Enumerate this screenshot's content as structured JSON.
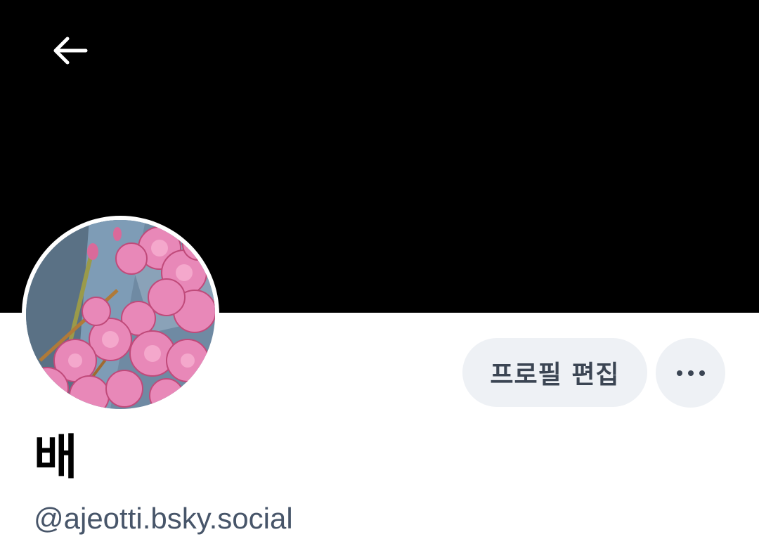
{
  "profile": {
    "display_name": "배",
    "handle": "@ajeotti.bsky.social"
  },
  "actions": {
    "edit_profile_label": "프로필 편집",
    "more_icon": "more-horizontal-icon",
    "back_icon": "arrow-left-icon"
  },
  "colors": {
    "banner": "#000000",
    "button_bg": "#eef1f5",
    "button_text": "#3b4553",
    "handle_text": "#475569"
  }
}
